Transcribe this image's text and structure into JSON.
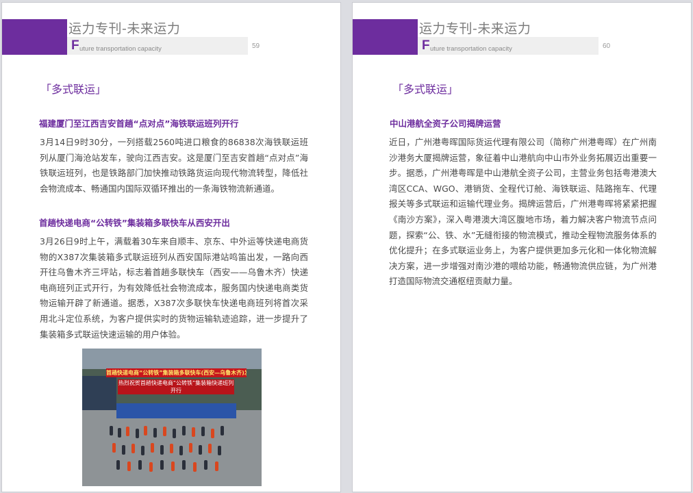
{
  "header": {
    "title": "运力专刊-未来运力",
    "sub_initial": "F",
    "sub_rest": "uture transportation capacity"
  },
  "pages": [
    {
      "number": "59",
      "section_label": "「多式联运」",
      "articles": [
        {
          "heading": "福建厦门至江西吉安首趟“点对点”海铁联运班列开行",
          "body": "3月14日9时30分，一列搭载2560吨进口粮食的86838次海铁联运班列从厦门海沧站发车，驶向江西吉安。这是厦门至吉安首趟“点对点”海铁联运班列，也是铁路部门加快推动铁路货运向现代物流转型，降低社会物流成本、畅通国内国际双循环推出的一条海铁物流新通道。"
        },
        {
          "heading": "首趟快递电商“公转铁”集装箱多联快车从西安开出",
          "body": "3月26日9时上午，满载着30车来自顺丰、京东、中外运等快递电商货物的X387次集装箱多式联运班列从西安国际港站鸣笛出发，一路向西开往乌鲁木齐三坪站，标志着首趟多联快车（西安——乌鲁木齐）快递电商班列正式开行，为有效降低社会物流成本，服务国内快递电商类货物运输开辟了新通道。据悉，X387次多联快车快递电商班列将首次采用北斗定位系统，为客户提供实时的货物运输轨迹追踪，进一步提升了集装箱多式联运快速运输的用户体验。"
        }
      ],
      "photo": {
        "banner_top": "首趟快递电商“公转铁”集装箱多联快车(西安—乌鲁木齐)发车仪式暨推介活动",
        "banner_main": "热烈祝贺首趟快递电商“公转铁”集装箱快递班列开行"
      }
    },
    {
      "number": "60",
      "section_label": "「多式联运」",
      "articles": [
        {
          "heading": "中山港航全资子公司揭牌运营",
          "body": "近日，广州港粤晖国际货运代理有限公司（简称广州港粤晖）在广州南沙港务大厦揭牌运营，象征着中山港航向中山市外业务拓展迈出重要一步。据悉，广州港粤晖是中山港航全资子公司，主营业务包括粤港澳大湾区CCA、WGO、港销货、全程代订舱、海铁联运、陆路拖车、代理报关等多式联运和运输代理业务。揭牌运营后，广州港粤晖将紧紧把握《南沙方案》，深入粤港澳大湾区腹地市场，着力解决客户物流节点问题，探索“公、铁、水”无缝衔接的物流模式，推动全程物流服务体系的优化提升；在多式联运业务上，为客户提供更加多元化和一体化物流解决方案，进一步增强对南沙港的喂给功能，畅通物流供应链，为广州港打造国际物流交通枢纽贡献力量。"
        }
      ]
    }
  ]
}
